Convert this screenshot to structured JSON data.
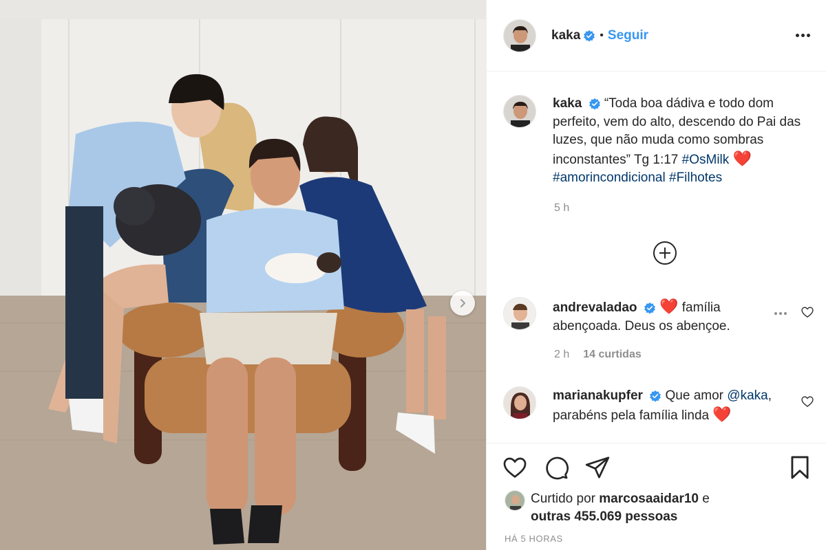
{
  "header": {
    "username": "kaka",
    "separator": "•",
    "follow_label": "Seguir"
  },
  "caption": {
    "username": "kaka",
    "text_part1": "“Toda boa dádiva e todo dom perfeito, vem do alto, descendo do Pai das luzes, que não muda como sombras inconstantes” Tg 1:17",
    "hashtag1": "#OsMilk",
    "emoji": "❤️",
    "hashtag2": "#amorincondicional",
    "hashtag3": "#Filhotes",
    "time": "5 h"
  },
  "comments": [
    {
      "username": "andrevaladao",
      "emoji": "❤️",
      "text": "família abençoada. Deus os abençoe.",
      "time": "2 h",
      "likes": "14 curtidas"
    },
    {
      "username": "marianakupfer",
      "text_before": "Que amor",
      "mention": "@kaka",
      "text_after": ", parabéns pela família linda",
      "emoji": "❤️"
    }
  ],
  "likes": {
    "prefix": "Curtido por",
    "user": "marcosaaidar10",
    "connector": "e",
    "others": "outras 455.069 pessoas"
  },
  "posted": "HÁ 5 HORAS",
  "colors": {
    "accent_blue": "#3897f0",
    "hashtag_blue": "#00376b",
    "muted_gray": "#8e8e8e",
    "heart_red": "#e0261f"
  },
  "icons": [
    "verified-badge-icon",
    "more-options-icon",
    "load-more-plus-icon",
    "heart-icon",
    "comment-icon",
    "share-icon",
    "bookmark-icon",
    "next-arrow-icon"
  ]
}
